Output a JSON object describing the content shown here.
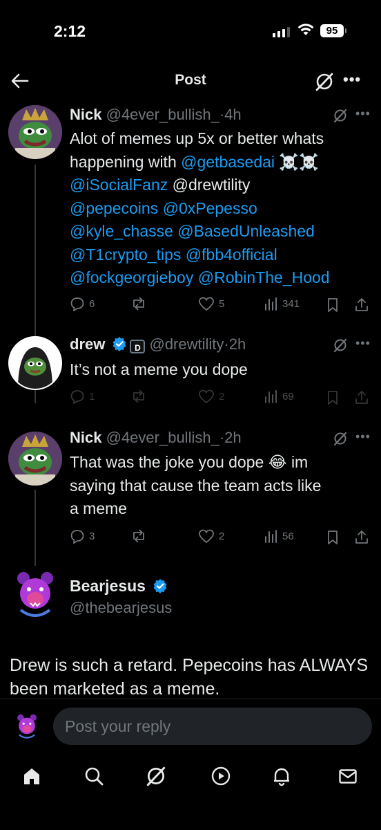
{
  "status": {
    "time": "2:12",
    "battery": "95"
  },
  "header": {
    "title": "Post"
  },
  "posts": [
    {
      "name": "Nick",
      "handle": "@4ever_bullish_",
      "time": "·4h",
      "text_lines": [
        [
          {
            "t": "Alot of memes up 5x or better whats",
            "m": false
          }
        ],
        [
          {
            "t": "happening with ",
            "m": false
          },
          {
            "t": "@getbasedai",
            "m": true
          },
          {
            "t": " ☠️☠️",
            "m": false
          }
        ],
        [
          {
            "t": "@iSocialFanz",
            "m": true
          },
          {
            "t": " @drewtility",
            "m": false
          }
        ],
        [
          {
            "t": "@pepecoins",
            "m": true
          },
          {
            "t": " ",
            "m": false
          },
          {
            "t": "@0xPepesso",
            "m": true
          }
        ],
        [
          {
            "t": "@kyle_chasse",
            "m": true
          },
          {
            "t": " ",
            "m": false
          },
          {
            "t": "@BasedUnleashed",
            "m": true
          }
        ],
        [
          {
            "t": "@T1crypto_tips",
            "m": true
          },
          {
            "t": " ",
            "m": false
          },
          {
            "t": "@fbb4official",
            "m": true
          }
        ],
        [
          {
            "t": "@fockgeorgieboy",
            "m": true
          },
          {
            "t": " ",
            "m": false
          },
          {
            "t": "@RobinThe_Hood",
            "m": true
          }
        ]
      ],
      "replies": "6",
      "reposts": "",
      "likes": "5",
      "views": "341"
    },
    {
      "name": "drew",
      "handle": "@drewtility",
      "time": "·2h",
      "badge_letter": "D",
      "text_lines": [
        [
          {
            "t": "It’s not a meme you dope",
            "m": false
          }
        ]
      ],
      "replies": "1",
      "reposts": "",
      "likes": "2",
      "views": "69"
    },
    {
      "name": "Nick",
      "handle": "@4ever_bullish_",
      "time": "·2h",
      "text_lines": [
        [
          {
            "t": "That was the joke you dope 😂 im",
            "m": false
          }
        ],
        [
          {
            "t": "saying that cause the team acts like",
            "m": false
          }
        ],
        [
          {
            "t": "a meme",
            "m": false
          }
        ]
      ],
      "replies": "3",
      "reposts": "",
      "likes": "2",
      "views": "56"
    }
  ],
  "quoted": {
    "name": "Bearjesus",
    "handle": "@thebearjesus",
    "text": "Drew is such a retard. Pepecoins has ALWAYS been marketed as a meme."
  },
  "reply": {
    "placeholder": "Post your reply"
  },
  "colors": {
    "mention": "#1d9bf0",
    "muted": "#71767b",
    "background": "#000000",
    "verified": "#1d9bf0"
  },
  "icons": {
    "top": [
      "back-arrow-icon",
      "grok-icon",
      "more-icon"
    ],
    "tabbar": [
      "home-icon",
      "search-icon",
      "grok-icon",
      "play-icon",
      "bell-icon",
      "mail-icon"
    ]
  }
}
